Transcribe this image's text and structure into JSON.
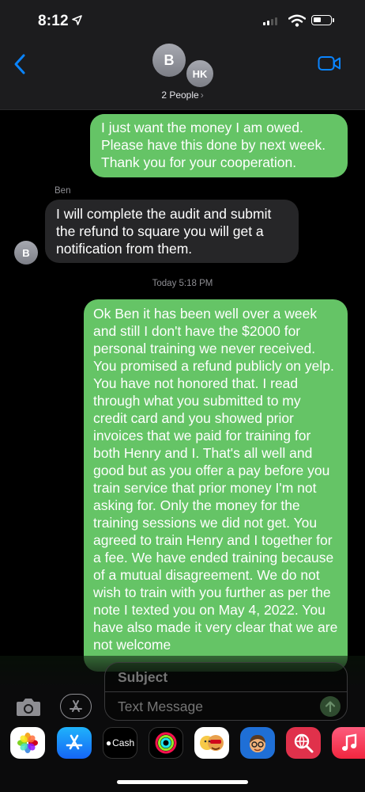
{
  "status_bar": {
    "time": "8:12"
  },
  "header": {
    "avatar_1_initial": "B",
    "avatar_2_initials": "HK",
    "participants_label": "2 People",
    "chevron": "›"
  },
  "messages": [
    {
      "direction": "outgoing",
      "text": "I just want the money I am owed. Please have this done by next week. Thank you for your cooperation."
    },
    {
      "direction": "incoming",
      "sender": "Ben",
      "avatar": "B",
      "text": "I will complete the audit and submit the refund to square you will get a notification from them."
    },
    {
      "direction": "outgoing",
      "text": "Ok Ben it has been well over a week and still I don't have the $2000 for personal training we never received. You promised a refund publicly on yelp. You have not honored that. I read through what you submitted to my credit card and you showed prior invoices that we paid for training for both Henry and I. That's all well and good but as you offer a pay before you train service that prior money I'm not asking for. Only the money for the training sessions we did not get. You agreed to train Henry and I together for a fee. We have ended training because of a mutual disagreement. We do not wish to train with you further as per the note I texted you on May 4, 2022. You have also made it very clear that we are not welcome"
    }
  ],
  "timestamp": "Today 5:18 PM",
  "composer": {
    "subject_placeholder": "Subject",
    "message_placeholder": "Text Message"
  },
  "app_drawer": [
    {
      "name": "photos-icon"
    },
    {
      "name": "app-store-icon"
    },
    {
      "name": "apple-cash-icon",
      "label": "Cash"
    },
    {
      "name": "activity-icon"
    },
    {
      "name": "memoji-stickers-icon"
    },
    {
      "name": "memoji-icon"
    },
    {
      "name": "web-search-icon"
    },
    {
      "name": "music-icon"
    }
  ],
  "colors": {
    "outgoing_bubble": "#65c466",
    "incoming_bubble": "#262628",
    "accent_blue": "#0a84ff",
    "header_bg": "#1c1c1e"
  }
}
